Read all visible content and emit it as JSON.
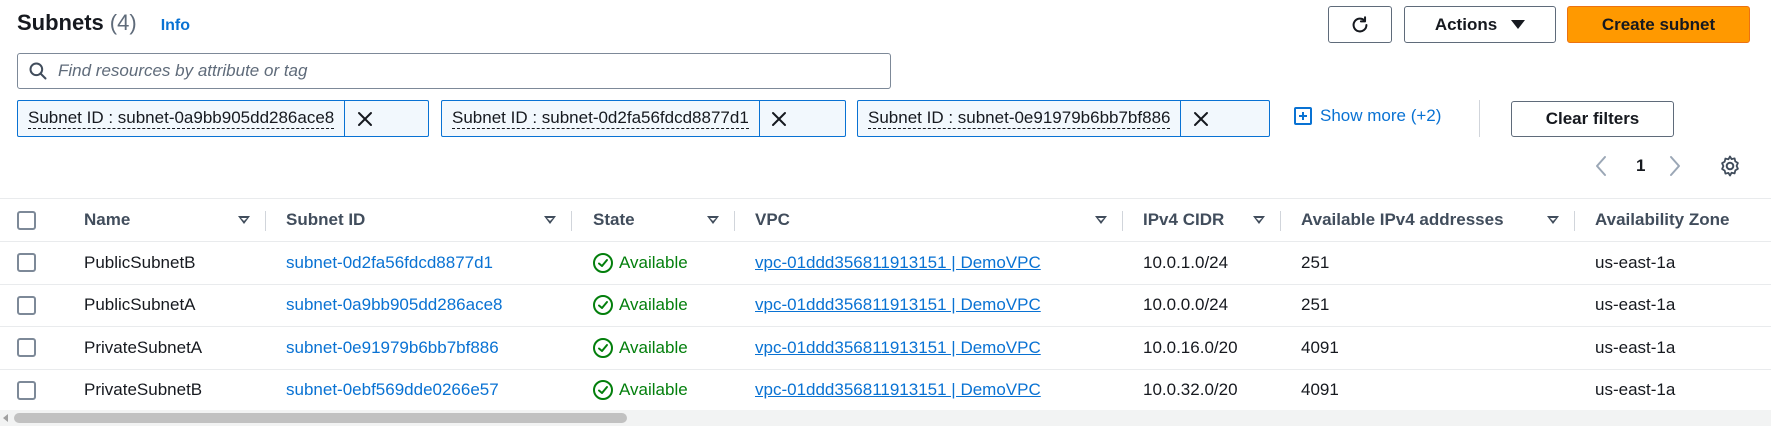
{
  "header": {
    "title": "Subnets",
    "count": "(4)",
    "info": "Info"
  },
  "toolbar": {
    "refresh_icon": "refresh-icon",
    "actions_label": "Actions",
    "create_label": "Create subnet",
    "primary_color": "#ff9900"
  },
  "search": {
    "placeholder": "Find resources by attribute or tag",
    "value": ""
  },
  "filters": {
    "tokens": [
      {
        "label": "Subnet ID : subnet-0a9bb905dd286ace8"
      },
      {
        "label": "Subnet ID : subnet-0d2fa56fdcd8877d1"
      },
      {
        "label": "Subnet ID : subnet-0e91979b6bb7bf886"
      }
    ],
    "show_more": "Show more (+2)",
    "clear": "Clear filters"
  },
  "pagination": {
    "current": "1"
  },
  "table": {
    "columns": [
      "Name",
      "Subnet ID",
      "State",
      "VPC",
      "IPv4 CIDR",
      "Available IPv4 addresses",
      "Availability Zone"
    ],
    "rows": [
      {
        "name": "PublicSubnetB",
        "id": "subnet-0d2fa56fdcd8877d1",
        "state": "Available",
        "vpc": "vpc-01ddd356811913151 | DemoVPC",
        "cidr": "10.0.1.0/24",
        "avail": "251",
        "az": "us-east-1a"
      },
      {
        "name": "PublicSubnetA",
        "id": "subnet-0a9bb905dd286ace8",
        "state": "Available",
        "vpc": "vpc-01ddd356811913151 | DemoVPC",
        "cidr": "10.0.0.0/24",
        "avail": "251",
        "az": "us-east-1a"
      },
      {
        "name": "PrivateSubnetA",
        "id": "subnet-0e91979b6bb7bf886",
        "state": "Available",
        "vpc": "vpc-01ddd356811913151 | DemoVPC",
        "cidr": "10.0.16.0/20",
        "avail": "4091",
        "az": "us-east-1a"
      },
      {
        "name": "PrivateSubnetB",
        "id": "subnet-0ebf569dde0266e57",
        "state": "Available",
        "vpc": "vpc-01ddd356811913151 | DemoVPC",
        "cidr": "10.0.32.0/20",
        "avail": "4091",
        "az": "us-east-1a"
      }
    ]
  },
  "colors": {
    "link": "#0972d3",
    "success": "#037f0c"
  }
}
